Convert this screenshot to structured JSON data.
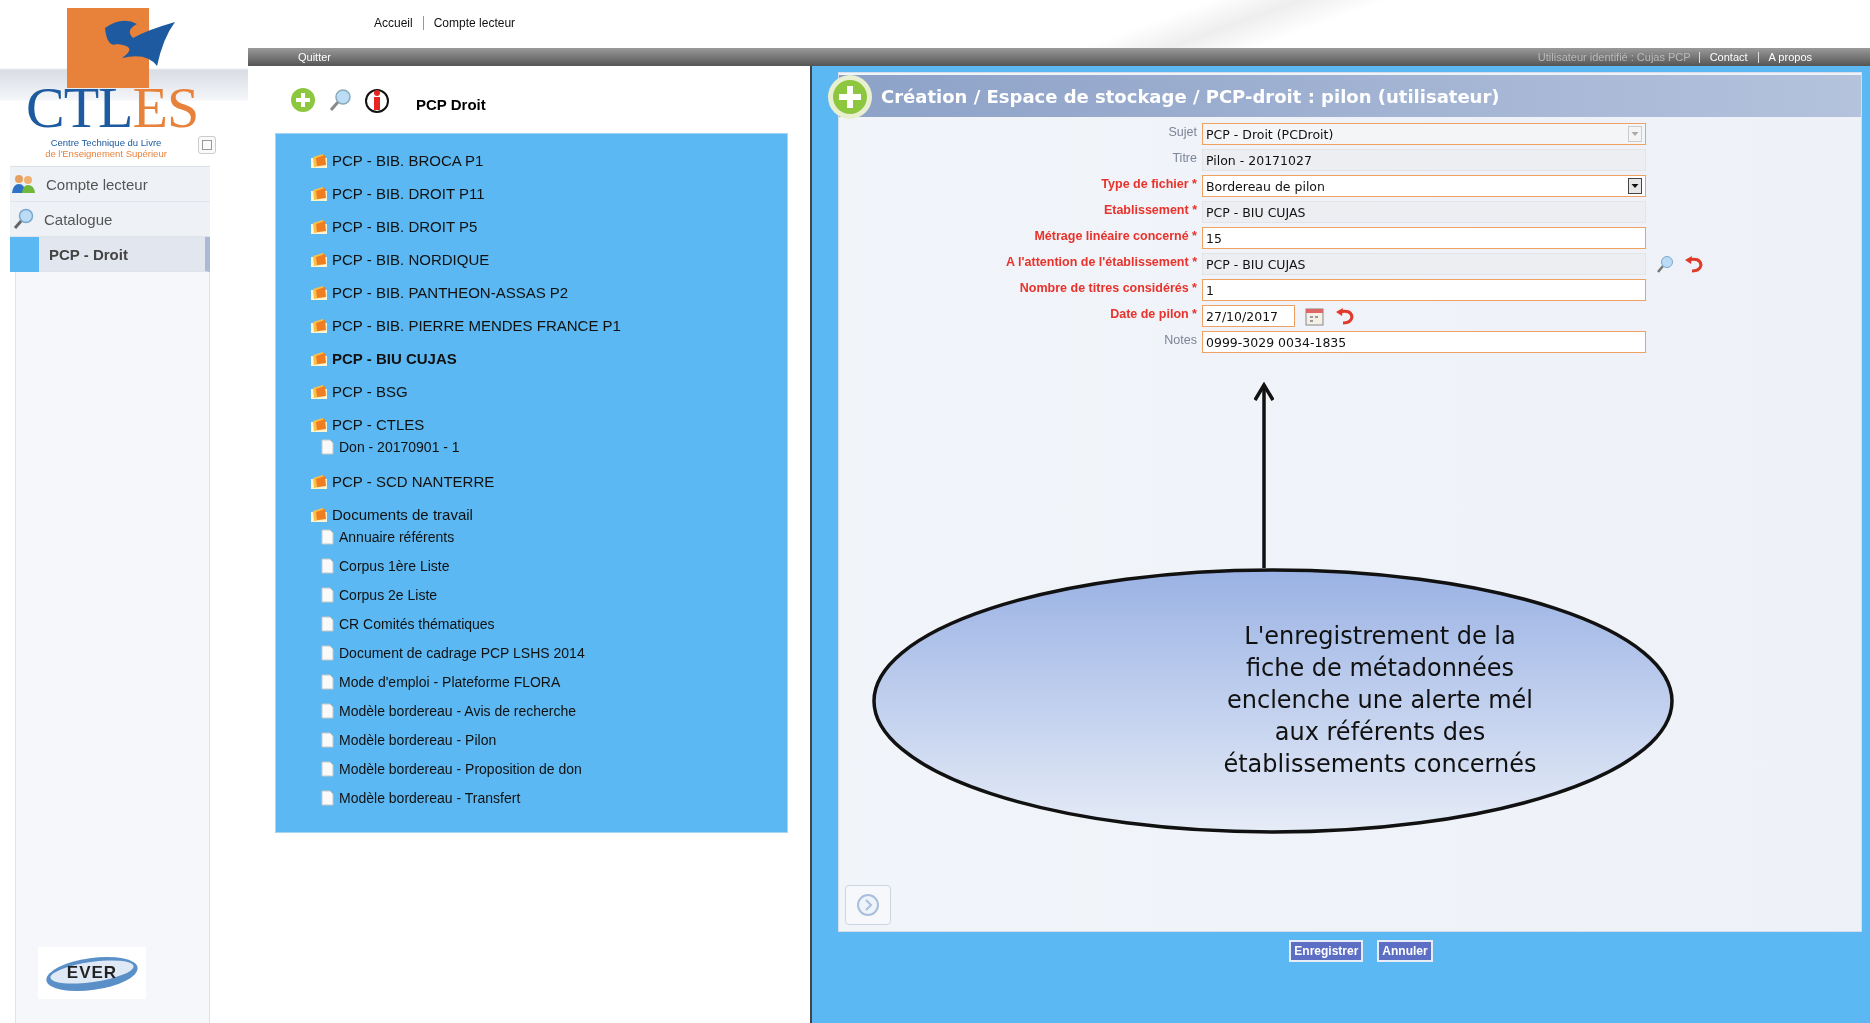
{
  "top_links": [
    {
      "label": "Accueil"
    },
    {
      "label": "Compte lecteur"
    }
  ],
  "top_bar": {
    "quit": "Quitter",
    "user": "Utilisateur identifié : Cujas PCP",
    "links": [
      "Contact",
      "A propos"
    ]
  },
  "logo": {
    "wordmark": "CTLES",
    "subtitle": [
      "Centre Technique du Livre",
      "de l'Enseignement Supérieur"
    ]
  },
  "sidebar": {
    "items": [
      {
        "label": "Compte lecteur",
        "selected": false
      },
      {
        "label": "Catalogue",
        "selected": false
      },
      {
        "label": "PCP - Droit",
        "selected": true
      }
    ]
  },
  "partner_logo": "EVER",
  "tree_panel": {
    "title": "PCP Droit",
    "nodes": [
      {
        "label": "PCP - BIB. BROCA P1",
        "selected": false
      },
      {
        "label": "PCP - BIB. DROIT P11",
        "selected": false
      },
      {
        "label": "PCP - BIB. DROIT P5",
        "selected": false
      },
      {
        "label": "PCP - BIB. NORDIQUE",
        "selected": false
      },
      {
        "label": "PCP - BIB. PANTHEON-ASSAS P2",
        "selected": false
      },
      {
        "label": "PCP - BIB. PIERRE MENDES FRANCE P1",
        "selected": false
      },
      {
        "label": "PCP - BIU CUJAS",
        "selected": true
      },
      {
        "label": "PCP - BSG",
        "selected": false
      },
      {
        "label": "PCP - CTLES",
        "selected": false,
        "children": [
          {
            "label": "Don - 20170901 - 1",
            "selected": false
          }
        ]
      },
      {
        "label": "PCP - SCD NANTERRE",
        "selected": false
      },
      {
        "label": "Documents de travail",
        "selected": false,
        "children": [
          {
            "label": "Annuaire référents",
            "selected": false
          },
          {
            "label": "Corpus 1ère Liste",
            "selected": false
          },
          {
            "label": "Corpus 2e Liste",
            "selected": false
          },
          {
            "label": "CR Comités thématiques",
            "selected": false
          },
          {
            "label": "Document de cadrage PCP LSHS 2014",
            "selected": false
          },
          {
            "label": "Mode d'emploi - Plateforme FLORA",
            "selected": false
          },
          {
            "label": "Modèle bordereau - Avis de recherche",
            "selected": false
          },
          {
            "label": "Modèle bordereau - Pilon",
            "selected": false
          },
          {
            "label": "Modèle bordereau - Proposition de don",
            "selected": false
          },
          {
            "label": "Modèle bordereau - Transfert",
            "selected": false
          }
        ]
      }
    ]
  },
  "form": {
    "title": "Création / Espace de stockage / PCP-droit : pilon (utilisateur)",
    "fields": [
      {
        "label": "Sujet",
        "required": false,
        "kind": "select",
        "disabled": true,
        "value": "PCP - Droit (PCDroit)"
      },
      {
        "label": "Titre",
        "required": false,
        "kind": "text",
        "disabled": true,
        "value": "Pilon - 20171027"
      },
      {
        "label": "Type de fichier *",
        "required": true,
        "kind": "select",
        "disabled": false,
        "value": "Bordereau de pilon"
      },
      {
        "label": "Etablissement *",
        "required": true,
        "kind": "text",
        "disabled": true,
        "value": "PCP - BIU CUJAS"
      },
      {
        "label": "Métrage linéaire concerné *",
        "required": true,
        "kind": "text",
        "disabled": false,
        "value": "15"
      },
      {
        "label": "A l'attention de l'établissement *",
        "required": true,
        "kind": "lookup",
        "disabled": true,
        "value": "PCP - BIU CUJAS"
      },
      {
        "label": "Nombre de titres considérés *",
        "required": true,
        "kind": "text",
        "disabled": false,
        "value": "1"
      },
      {
        "label": "Date de pilon *",
        "required": true,
        "kind": "date",
        "disabled": false,
        "value": "27/10/2017"
      },
      {
        "label": "Notes",
        "required": false,
        "kind": "text",
        "disabled": false,
        "value": "0999-3029 0034-1835"
      }
    ],
    "buttons": [
      "Enregistrer",
      "Annuler"
    ]
  },
  "annotation": {
    "text": "L'enregistrement de la\nfiche de métadonnées\nenclenche une alerte mél\naux référents des\nétablissements concernés"
  }
}
